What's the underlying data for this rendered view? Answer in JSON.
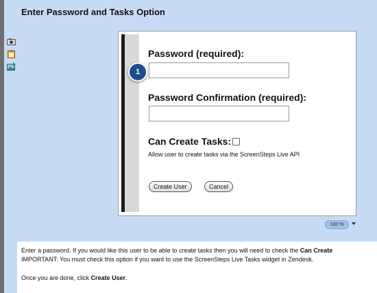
{
  "step": {
    "title": "Enter Password and Tasks Option"
  },
  "side_icons": [
    "camera-icon",
    "clipboard-icon",
    "image-add-icon"
  ],
  "form": {
    "step_marker": "1",
    "password_label": "Password (required):",
    "password_value": "",
    "confirmation_label": "Password Confirmation (required):",
    "confirmation_value": "",
    "can_create_tasks_label": "Can Create Tasks:",
    "can_create_tasks_checked": false,
    "help_text": "Allow user to create tasks via the ScreenSteps Live API",
    "create_button": "Create User",
    "cancel_button": "Cancel"
  },
  "zoom": {
    "level": "100 %"
  },
  "description": {
    "line1_text": "Enter a password. If you would like this user to be able to create tasks then you will need to check the ",
    "line1_bold": "Can Create",
    "line2_text": "IMPORTANT: You must check this option if you want to use the ScreenSteps Live Tasks widget in Zendesk.",
    "line3_text": "Once you are done, click ",
    "line3_bold": "Create User",
    "line3_end": "."
  },
  "colors": {
    "page_background": "#c7dcf4",
    "marker": "#1f4d8c",
    "zoom_pill": "#9fc0e8"
  }
}
